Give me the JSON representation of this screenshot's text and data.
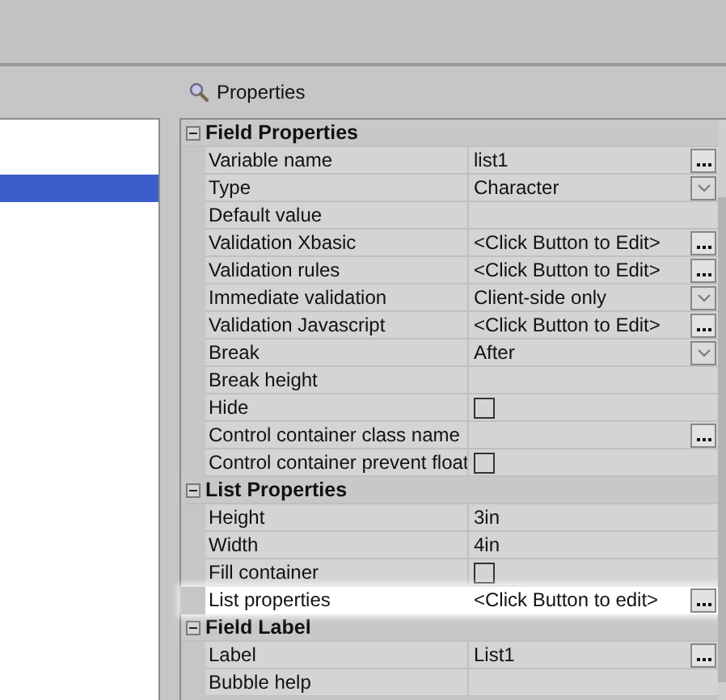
{
  "left_panel": {
    "rows": [
      {
        "selected": false
      },
      {
        "selected": false
      },
      {
        "selected": true
      }
    ]
  },
  "properties_panel": {
    "title": "Properties",
    "groups": [
      {
        "title": "Field Properties",
        "expanded": true,
        "rows": [
          {
            "name": "Variable name",
            "value": "list1",
            "kind": "ellipsis",
            "selected": false
          },
          {
            "name": "Type",
            "value": "Character",
            "kind": "dropdown",
            "selected": false
          },
          {
            "name": "Default value",
            "kind": "text",
            "selected": false
          },
          {
            "name": "Validation Xbasic",
            "value": "<Click Button to Edit>",
            "kind": "ellipsis",
            "selected": false
          },
          {
            "name": "Validation rules",
            "value": "<Click Button to Edit>",
            "kind": "ellipsis",
            "selected": false
          },
          {
            "name": "Immediate validation",
            "value": "Client-side only",
            "kind": "dropdown",
            "selected": false
          },
          {
            "name": "Validation Javascript",
            "value": "<Click Button to Edit>",
            "kind": "ellipsis",
            "selected": false
          },
          {
            "name": "Break",
            "value": "After",
            "kind": "dropdown",
            "selected": false
          },
          {
            "name": "Break height",
            "kind": "text",
            "selected": false
          },
          {
            "name": "Hide",
            "kind": "checkbox",
            "checked": false,
            "selected": false
          },
          {
            "name": "Control container class name",
            "kind": "ellipsis",
            "selected": false
          },
          {
            "name": "Control container prevent float",
            "kind": "checkbox",
            "checked": false,
            "selected": false
          }
        ]
      },
      {
        "title": "List Properties",
        "expanded": true,
        "rows": [
          {
            "name": "Height",
            "value": "3in",
            "kind": "text",
            "selected": false
          },
          {
            "name": "Width",
            "value": "4in",
            "kind": "text",
            "selected": false
          },
          {
            "name": "Fill container",
            "kind": "checkbox",
            "checked": false,
            "selected": false
          },
          {
            "name": "List properties",
            "value": "<Click Button to edit>",
            "kind": "ellipsis",
            "selected": true
          }
        ]
      },
      {
        "title": "Field Label",
        "expanded": true,
        "rows": [
          {
            "name": "Label",
            "value": "List1",
            "kind": "ellipsis",
            "selected": false
          },
          {
            "name": "Bubble help",
            "kind": "text",
            "selected": false
          }
        ]
      }
    ]
  }
}
